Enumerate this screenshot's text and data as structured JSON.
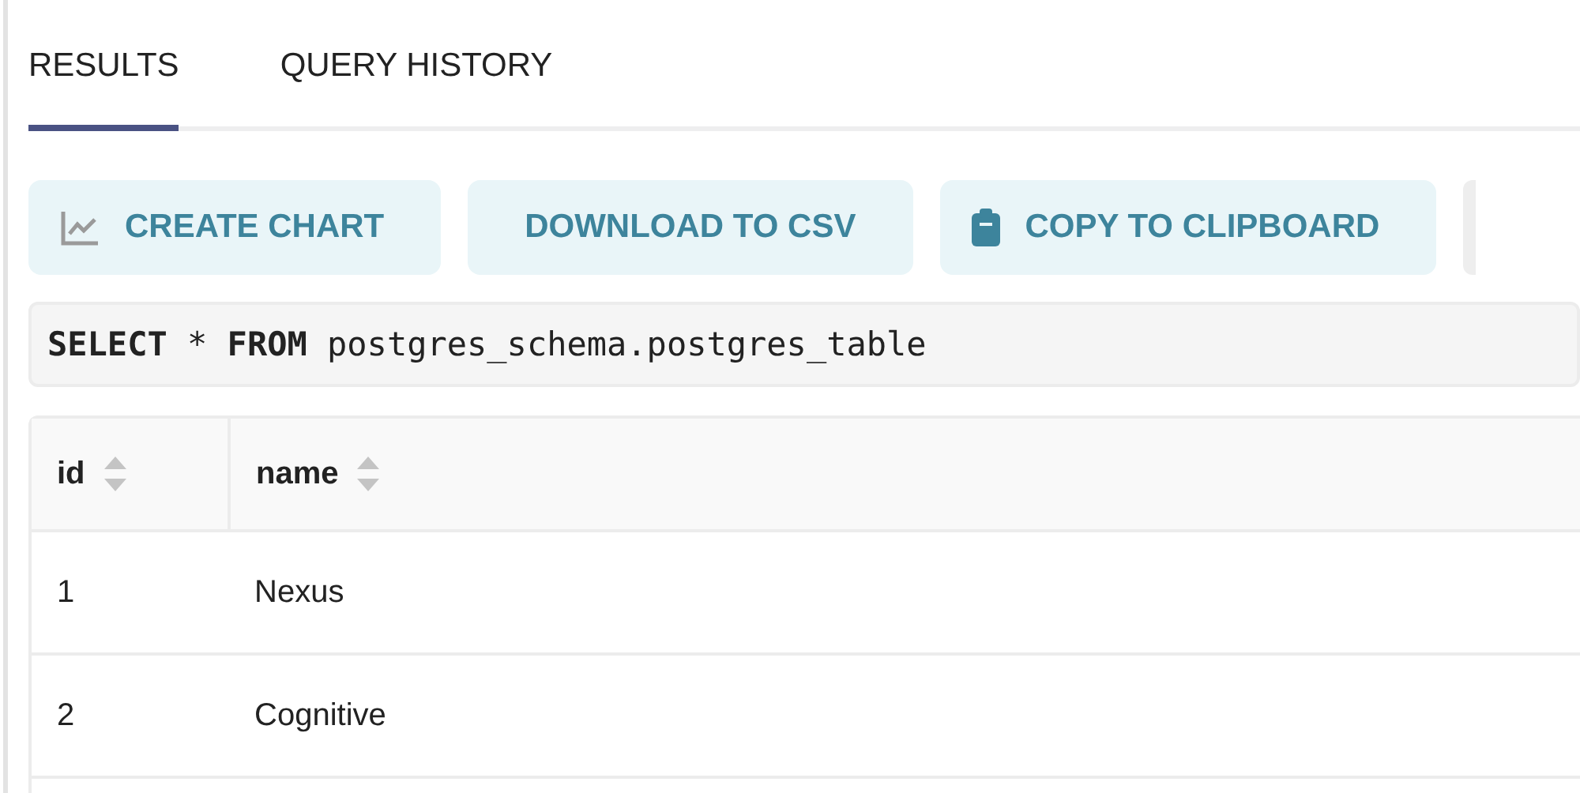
{
  "tabs": [
    {
      "label": "RESULTS",
      "selected": true
    },
    {
      "label": "QUERY HISTORY",
      "selected": false
    }
  ],
  "toolbar": [
    {
      "label": "CREATE CHART",
      "kind": "chart"
    },
    {
      "label": "DOWNLOAD TO CSV",
      "kind": "plain"
    },
    {
      "label": "COPY TO CLIPBOARD",
      "kind": "clipboard"
    }
  ],
  "query": "**SELECT** * **FROM** postgres_schema.postgres_table",
  "table": {
    "columns": [
      "id",
      "name"
    ],
    "rows": [
      [
        "1",
        "Nexus"
      ],
      [
        "2",
        "Cognitive"
      ]
    ]
  }
}
